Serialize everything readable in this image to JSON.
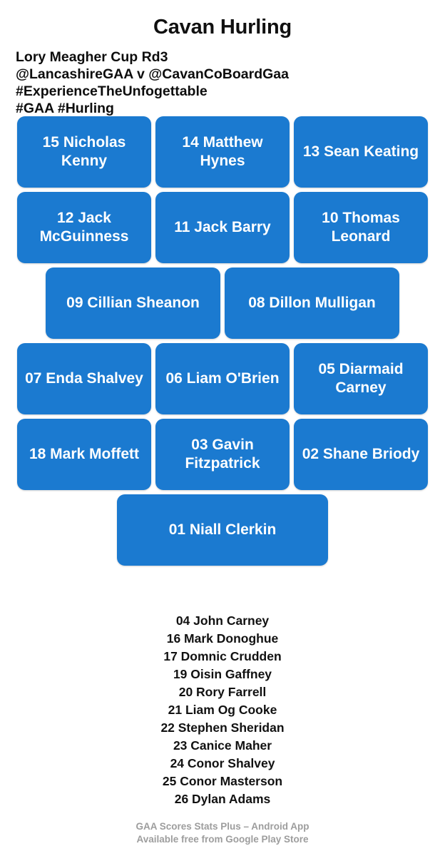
{
  "header": {
    "title": "Cavan Hurling",
    "meta_lines": [
      "Lory Meagher Cup Rd3",
      "@LancashireGAA v @CavanCoBoardGaa",
      "#ExperienceTheUnfogettable",
      "#GAA #Hurling"
    ]
  },
  "theme": {
    "card_blue": "#1B7AD0",
    "card_text": "#ffffff",
    "page_bg": "#ffffff",
    "text_black": "#101010",
    "footer_gray": "#9d9d9d"
  },
  "lineup": {
    "rows": [
      {
        "layout": "three",
        "players": [
          {
            "number": "15",
            "name": "Nicholas Kenny",
            "label": "15 Nicholas Kenny"
          },
          {
            "number": "14",
            "name": "Matthew Hynes",
            "label": "14 Matthew Hynes"
          },
          {
            "number": "13",
            "name": "Sean Keating",
            "label": "13 Sean Keating"
          }
        ]
      },
      {
        "layout": "three",
        "players": [
          {
            "number": "12",
            "name": "Jack McGuinness",
            "label": "12 Jack McGuinness"
          },
          {
            "number": "11",
            "name": "Jack Barry",
            "label": "11 Jack Barry"
          },
          {
            "number": "10",
            "name": "Thomas Leonard",
            "label": "10 Thomas Leonard"
          }
        ]
      },
      {
        "layout": "two",
        "players": [
          {
            "number": "09",
            "name": "Cillian Sheanon",
            "label": "09 Cillian Sheanon"
          },
          {
            "number": "08",
            "name": "Dillon Mulligan",
            "label": "08 Dillon Mulligan"
          }
        ]
      },
      {
        "layout": "three",
        "players": [
          {
            "number": "07",
            "name": "Enda Shalvey",
            "label": "07 Enda Shalvey"
          },
          {
            "number": "06",
            "name": "Liam O'Brien",
            "label": "06 Liam O'Brien"
          },
          {
            "number": "05",
            "name": "Diarmaid Carney",
            "label": "05 Diarmaid Carney"
          }
        ]
      },
      {
        "layout": "three",
        "players": [
          {
            "number": "18",
            "name": "Mark Moffett",
            "label": "18 Mark Moffett"
          },
          {
            "number": "03",
            "name": "Gavin Fitzpatrick",
            "label": "03 Gavin Fitzpatrick"
          },
          {
            "number": "02",
            "name": "Shane Briody",
            "label": "02 Shane Briody"
          }
        ]
      },
      {
        "layout": "one",
        "players": [
          {
            "number": "01",
            "name": "Niall Clerkin",
            "label": "01 Niall Clerkin"
          }
        ]
      }
    ]
  },
  "substitutes": [
    "04 John Carney",
    "16 Mark Donoghue",
    "17 Domnic Crudden",
    "19 Oisin Gaffney",
    "20 Rory Farrell",
    "21 Liam Og Cooke",
    "22 Stephen Sheridan",
    "23 Canice Maher",
    "24 Conor Shalvey",
    "25 Conor Masterson",
    "26 Dylan Adams"
  ],
  "footer": {
    "lines": [
      "GAA Scores Stats Plus – Android App",
      "Available free from Google Play Store"
    ]
  }
}
